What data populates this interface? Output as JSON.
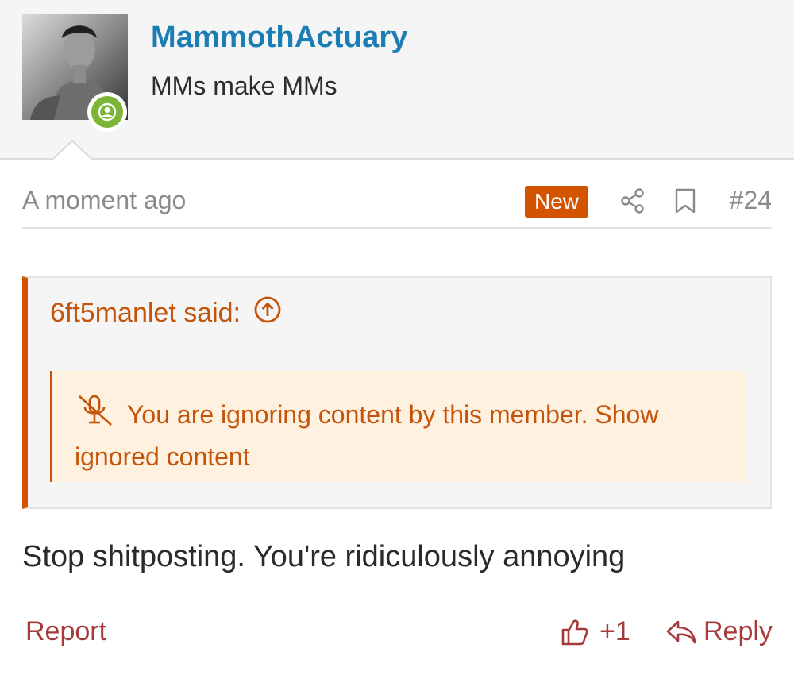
{
  "author": {
    "username": "MammothActuary",
    "user_title": "MMs make MMs",
    "avatar_icon": "avatar-photo",
    "online_icon": "online-user-icon"
  },
  "post_meta": {
    "timestamp": "A moment ago",
    "new_badge": "New",
    "share_icon": "share-icon",
    "bookmark_icon": "bookmark-icon",
    "post_number": "#24"
  },
  "quote": {
    "author_label": "6ft5manlet said:",
    "jump_icon": "arrow-up-circle-icon",
    "ignored_message": "You are ignoring content by this member.",
    "show_link": "Show ignored content"
  },
  "body": {
    "text": "Stop shitposting. You're ridiculously annoying"
  },
  "actions": {
    "report": "Report",
    "like_count": "+1",
    "reply": "Reply"
  },
  "colors": {
    "username": "#1a7eb5",
    "accent": "#d35400",
    "quote_text": "#c4540a",
    "action": "#a63a3a",
    "online": "#7bb536"
  }
}
